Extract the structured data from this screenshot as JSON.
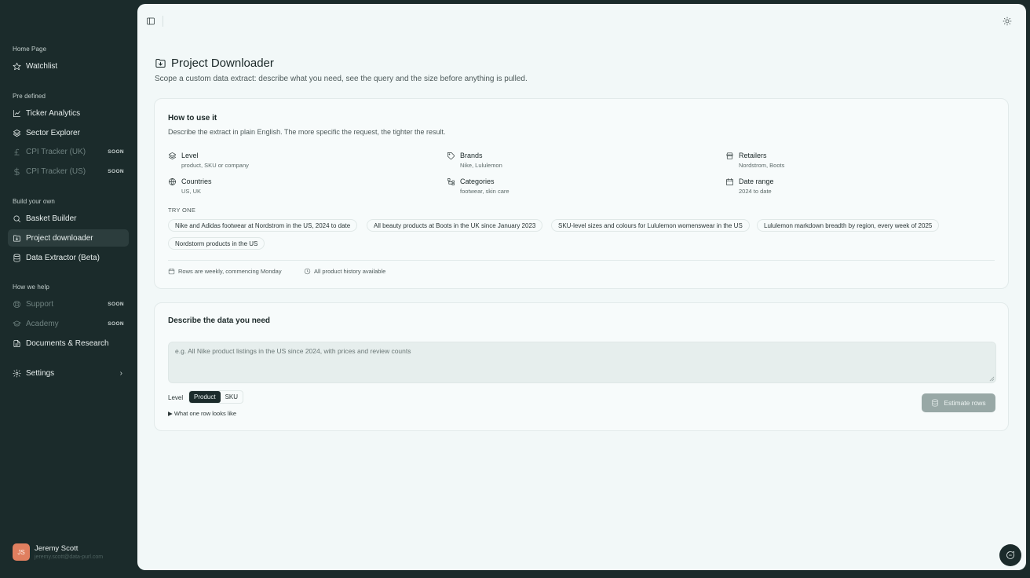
{
  "sidebar": {
    "sections": [
      {
        "title": "Home Page",
        "items": [
          {
            "label": "Watchlist",
            "icon": "star-icon"
          }
        ]
      },
      {
        "title": "Pre defined",
        "items": [
          {
            "label": "Ticker Analytics",
            "icon": "line-chart-icon"
          },
          {
            "label": "Sector Explorer",
            "icon": "layers-icon"
          },
          {
            "label": "CPI Tracker (UK)",
            "icon": "pound-icon",
            "badge": "SOON"
          },
          {
            "label": "CPI Tracker (US)",
            "icon": "dollar-icon",
            "badge": "SOON"
          }
        ]
      },
      {
        "title": "Build your own",
        "items": [
          {
            "label": "Basket Builder",
            "icon": "search-icon"
          },
          {
            "label": "Project downloader",
            "icon": "folder-download-icon"
          },
          {
            "label": "Data Extractor (Beta)",
            "icon": "database-icon"
          }
        ]
      },
      {
        "title": "How we help",
        "items": [
          {
            "label": "Support",
            "icon": "lifebuoy-icon",
            "badge": "SOON"
          },
          {
            "label": "Academy",
            "icon": "graduation-cap-icon",
            "badge": "SOON"
          },
          {
            "label": "Documents & Research",
            "icon": "document-icon"
          }
        ]
      }
    ],
    "settings_label": "Settings",
    "user": {
      "initials": "JS",
      "name": "Jeremy Scott",
      "email": "jeremy.scott@data-purl.com"
    }
  },
  "page": {
    "title": "Project Downloader",
    "subtitle": "Scope a custom data extract: describe what you need, see the query and the size before anything is pulled."
  },
  "how_to": {
    "title": "How to use it",
    "description": "Describe the extract in plain English. The more specific the request, the tighter the result.",
    "dimensions": [
      {
        "label": "Level",
        "sub": "product, SKU or company",
        "icon": "layers-icon"
      },
      {
        "label": "Brands",
        "sub": "Nike, Lululemon",
        "icon": "tag-icon"
      },
      {
        "label": "Retailers",
        "sub": "Nordstrom, Boots",
        "icon": "store-icon"
      },
      {
        "label": "Countries",
        "sub": "US, UK",
        "icon": "globe-icon"
      },
      {
        "label": "Categories",
        "sub": "footwear, skin care",
        "icon": "hierarchy-icon"
      },
      {
        "label": "Date range",
        "sub": "2024 to date",
        "icon": "calendar-icon"
      }
    ],
    "try_label": "TRY ONE",
    "examples": [
      "Nike and Adidas footwear at Nordstrom in the US, 2024 to date",
      "All beauty products at Boots in the UK since January 2023",
      "SKU-level sizes and colours for Lululemon womenswear in the US",
      "Lululemon markdown breadth by region, every week of 2025",
      "Nordstorm products in the US"
    ],
    "notes": [
      {
        "text": "Rows are weekly, commencing Monday",
        "icon": "calendar-icon"
      },
      {
        "text": "All product history available",
        "icon": "clock-icon"
      }
    ]
  },
  "request": {
    "title": "Describe the data you need",
    "placeholder": "e.g. All Nike product listings in the US since 2024, with prices and review counts",
    "value": "",
    "level_label": "Level",
    "level_options": [
      "Product",
      "SKU"
    ],
    "level_selected": "Product",
    "row_preview_label": "▶ What one row looks like",
    "estimate_label": "Estimate rows"
  },
  "colors": {
    "sidebar_bg": "#1b2b2b",
    "active_item_bg": "#2c3d3d",
    "main_bg": "#f2f8f8",
    "avatar_bg": "#e07f5f",
    "disabled_button": "#98a8a6"
  }
}
